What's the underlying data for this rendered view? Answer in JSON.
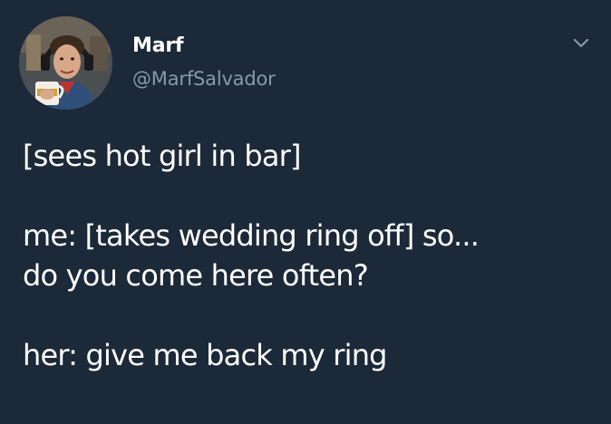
{
  "author": {
    "display_name": "Marf",
    "handle": "@MarfSalvador"
  },
  "menu_icon": "chevron-down-icon",
  "tweet": {
    "lines": [
      "[sees hot girl in bar]",
      "",
      "me: [takes wedding ring off] so...",
      "do you come here often?",
      "",
      "her: give me back my ring"
    ]
  },
  "colors": {
    "background": "#1c2938",
    "text": "#ffffff",
    "secondary_text": "#8899a6"
  }
}
